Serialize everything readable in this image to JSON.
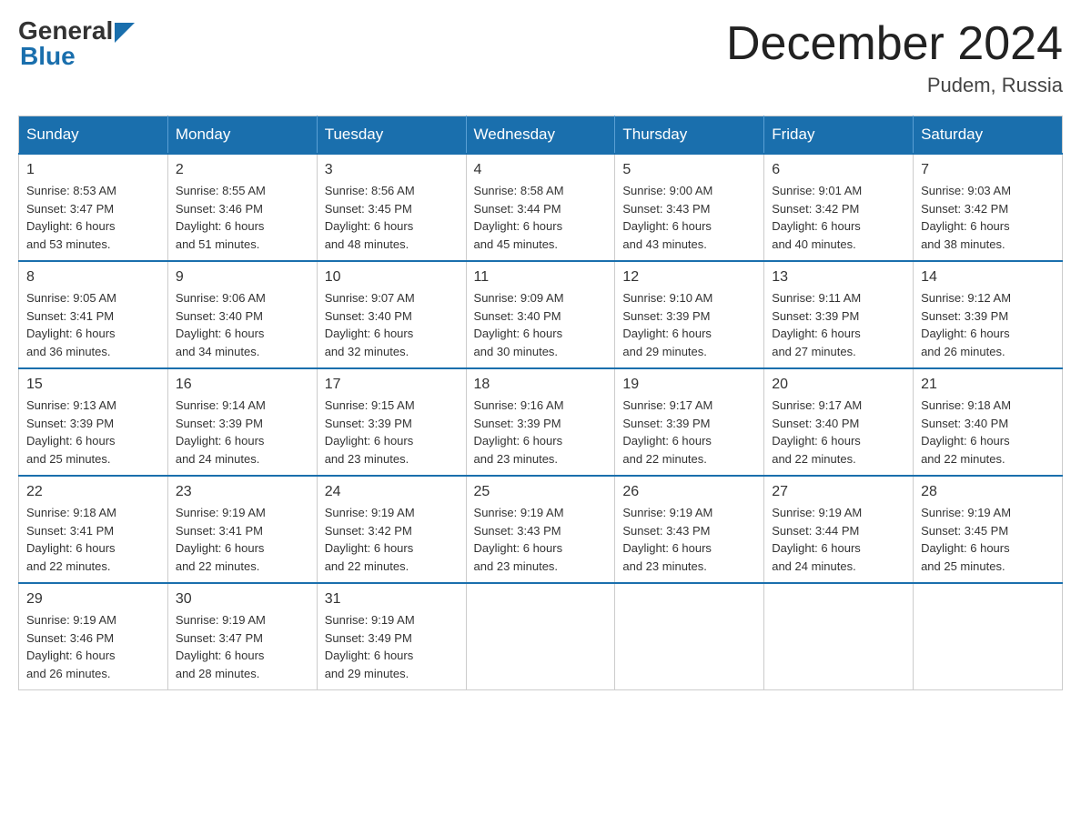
{
  "header": {
    "logo_general": "General",
    "logo_blue": "Blue",
    "month_title": "December 2024",
    "location": "Pudem, Russia"
  },
  "days_of_week": [
    "Sunday",
    "Monday",
    "Tuesday",
    "Wednesday",
    "Thursday",
    "Friday",
    "Saturday"
  ],
  "weeks": [
    [
      {
        "day": "1",
        "sunrise": "8:53 AM",
        "sunset": "3:47 PM",
        "daylight": "6 hours and 53 minutes."
      },
      {
        "day": "2",
        "sunrise": "8:55 AM",
        "sunset": "3:46 PM",
        "daylight": "6 hours and 51 minutes."
      },
      {
        "day": "3",
        "sunrise": "8:56 AM",
        "sunset": "3:45 PM",
        "daylight": "6 hours and 48 minutes."
      },
      {
        "day": "4",
        "sunrise": "8:58 AM",
        "sunset": "3:44 PM",
        "daylight": "6 hours and 45 minutes."
      },
      {
        "day": "5",
        "sunrise": "9:00 AM",
        "sunset": "3:43 PM",
        "daylight": "6 hours and 43 minutes."
      },
      {
        "day": "6",
        "sunrise": "9:01 AM",
        "sunset": "3:42 PM",
        "daylight": "6 hours and 40 minutes."
      },
      {
        "day": "7",
        "sunrise": "9:03 AM",
        "sunset": "3:42 PM",
        "daylight": "6 hours and 38 minutes."
      }
    ],
    [
      {
        "day": "8",
        "sunrise": "9:05 AM",
        "sunset": "3:41 PM",
        "daylight": "6 hours and 36 minutes."
      },
      {
        "day": "9",
        "sunrise": "9:06 AM",
        "sunset": "3:40 PM",
        "daylight": "6 hours and 34 minutes."
      },
      {
        "day": "10",
        "sunrise": "9:07 AM",
        "sunset": "3:40 PM",
        "daylight": "6 hours and 32 minutes."
      },
      {
        "day": "11",
        "sunrise": "9:09 AM",
        "sunset": "3:40 PM",
        "daylight": "6 hours and 30 minutes."
      },
      {
        "day": "12",
        "sunrise": "9:10 AM",
        "sunset": "3:39 PM",
        "daylight": "6 hours and 29 minutes."
      },
      {
        "day": "13",
        "sunrise": "9:11 AM",
        "sunset": "3:39 PM",
        "daylight": "6 hours and 27 minutes."
      },
      {
        "day": "14",
        "sunrise": "9:12 AM",
        "sunset": "3:39 PM",
        "daylight": "6 hours and 26 minutes."
      }
    ],
    [
      {
        "day": "15",
        "sunrise": "9:13 AM",
        "sunset": "3:39 PM",
        "daylight": "6 hours and 25 minutes."
      },
      {
        "day": "16",
        "sunrise": "9:14 AM",
        "sunset": "3:39 PM",
        "daylight": "6 hours and 24 minutes."
      },
      {
        "day": "17",
        "sunrise": "9:15 AM",
        "sunset": "3:39 PM",
        "daylight": "6 hours and 23 minutes."
      },
      {
        "day": "18",
        "sunrise": "9:16 AM",
        "sunset": "3:39 PM",
        "daylight": "6 hours and 23 minutes."
      },
      {
        "day": "19",
        "sunrise": "9:17 AM",
        "sunset": "3:39 PM",
        "daylight": "6 hours and 22 minutes."
      },
      {
        "day": "20",
        "sunrise": "9:17 AM",
        "sunset": "3:40 PM",
        "daylight": "6 hours and 22 minutes."
      },
      {
        "day": "21",
        "sunrise": "9:18 AM",
        "sunset": "3:40 PM",
        "daylight": "6 hours and 22 minutes."
      }
    ],
    [
      {
        "day": "22",
        "sunrise": "9:18 AM",
        "sunset": "3:41 PM",
        "daylight": "6 hours and 22 minutes."
      },
      {
        "day": "23",
        "sunrise": "9:19 AM",
        "sunset": "3:41 PM",
        "daylight": "6 hours and 22 minutes."
      },
      {
        "day": "24",
        "sunrise": "9:19 AM",
        "sunset": "3:42 PM",
        "daylight": "6 hours and 22 minutes."
      },
      {
        "day": "25",
        "sunrise": "9:19 AM",
        "sunset": "3:43 PM",
        "daylight": "6 hours and 23 minutes."
      },
      {
        "day": "26",
        "sunrise": "9:19 AM",
        "sunset": "3:43 PM",
        "daylight": "6 hours and 23 minutes."
      },
      {
        "day": "27",
        "sunrise": "9:19 AM",
        "sunset": "3:44 PM",
        "daylight": "6 hours and 24 minutes."
      },
      {
        "day": "28",
        "sunrise": "9:19 AM",
        "sunset": "3:45 PM",
        "daylight": "6 hours and 25 minutes."
      }
    ],
    [
      {
        "day": "29",
        "sunrise": "9:19 AM",
        "sunset": "3:46 PM",
        "daylight": "6 hours and 26 minutes."
      },
      {
        "day": "30",
        "sunrise": "9:19 AM",
        "sunset": "3:47 PM",
        "daylight": "6 hours and 28 minutes."
      },
      {
        "day": "31",
        "sunrise": "9:19 AM",
        "sunset": "3:49 PM",
        "daylight": "6 hours and 29 minutes."
      },
      null,
      null,
      null,
      null
    ]
  ],
  "labels": {
    "sunrise": "Sunrise:",
    "sunset": "Sunset:",
    "daylight": "Daylight:"
  },
  "colors": {
    "header_bg": "#1a6fad",
    "border_top": "#1a6fad"
  }
}
